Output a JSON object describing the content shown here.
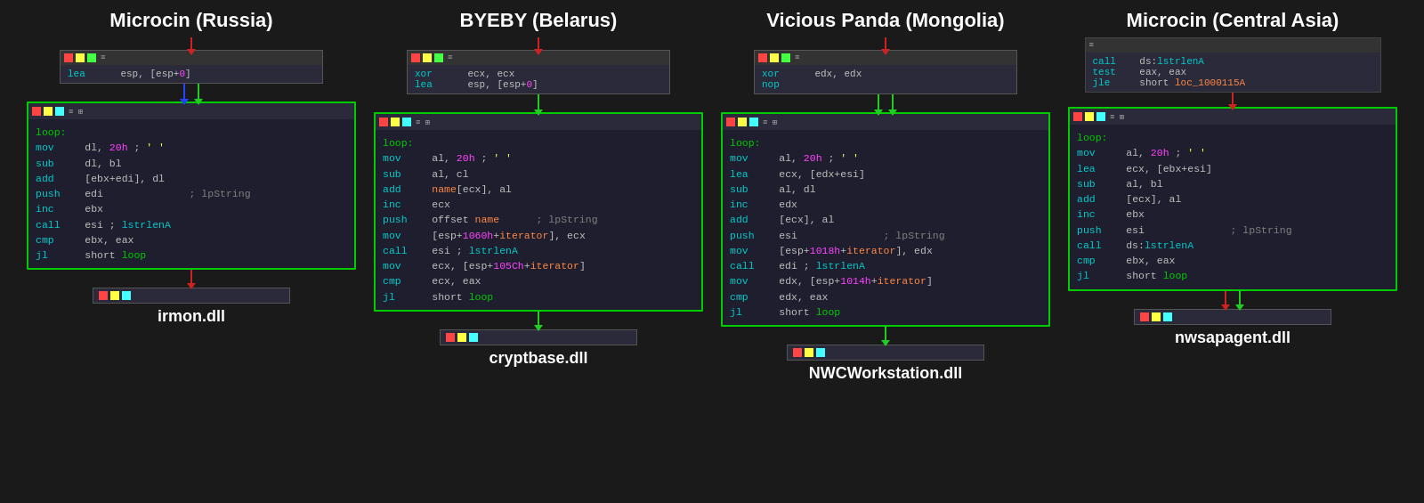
{
  "columns": [
    {
      "id": "col1",
      "title": "Microcin (Russia)",
      "snippet": {
        "lines": [
          {
            "text": "lea      esp, [esp+0]",
            "parts": [
              {
                "t": "lea",
                "c": "kw"
              },
              {
                "t": "      esp, [esp+0]",
                "c": "reg"
              }
            ]
          }
        ]
      },
      "main_code": {
        "lines": [
          {
            "raw": "loop:"
          },
          {
            "raw": "mov      dl, 20h ; ' '"
          },
          {
            "raw": "sub      dl, bl"
          },
          {
            "raw": "add      [ebx+edi], dl"
          },
          {
            "raw": "push     edi              ; lpString"
          },
          {
            "raw": "inc      ebx"
          },
          {
            "raw": "call     esi ; lstrlenA"
          },
          {
            "raw": "cmp      ebx, eax"
          },
          {
            "raw": "jl       short loop"
          }
        ]
      },
      "filename": "irmon.dll"
    },
    {
      "id": "col2",
      "title": "BYEBY (Belarus)",
      "snippet": {
        "lines": [
          {
            "raw": "xor      ecx, ecx"
          },
          {
            "raw": "lea      esp, [esp+0]"
          }
        ]
      },
      "main_code": {
        "lines": [
          {
            "raw": "loop:"
          },
          {
            "raw": "mov      al, 20h ; ' '"
          },
          {
            "raw": "sub      al, cl"
          },
          {
            "raw": "add      name[ecx], al"
          },
          {
            "raw": "inc      ecx"
          },
          {
            "raw": "push     offset name      ; lpString"
          },
          {
            "raw": "mov      [esp+1060h+iterator], ecx"
          },
          {
            "raw": "call     esi ; lstrlenA"
          },
          {
            "raw": "mov      ecx, [esp+105Ch+iterator]"
          },
          {
            "raw": "cmp      ecx, eax"
          },
          {
            "raw": "jl       short loop"
          }
        ]
      },
      "filename": "cryptbase.dll"
    },
    {
      "id": "col3",
      "title": "Vicious Panda (Mongolia)",
      "snippet": {
        "lines": [
          {
            "raw": "xor      edx, edx"
          },
          {
            "raw": "nop"
          }
        ]
      },
      "main_code": {
        "lines": [
          {
            "raw": "loop:"
          },
          {
            "raw": "mov      al, 20h ; ' '"
          },
          {
            "raw": "lea      ecx, [edx+esi]"
          },
          {
            "raw": "sub      al, dl"
          },
          {
            "raw": "inc      edx"
          },
          {
            "raw": "add      [ecx], al"
          },
          {
            "raw": "push     esi              ; lpString"
          },
          {
            "raw": "mov      [esp+1018h+iterator], edx"
          },
          {
            "raw": "call     edi ; lstrlenA"
          },
          {
            "raw": "mov      edx, [esp+1014h+iterator]"
          },
          {
            "raw": "cmp      edx, eax"
          },
          {
            "raw": "jl       short loop"
          }
        ]
      },
      "filename": "NWCWorkstation.dll"
    },
    {
      "id": "col4",
      "title": "Microcin (Central Asia)",
      "snippet": {
        "lines": [
          {
            "raw": "call     ds:lstrlenA"
          },
          {
            "raw": "test     eax, eax"
          },
          {
            "raw": "jle      short loc_1000115A"
          }
        ]
      },
      "main_code": {
        "lines": [
          {
            "raw": "loop:"
          },
          {
            "raw": "mov      al, 20h ; ' '"
          },
          {
            "raw": "lea      ecx, [ebx+esi]"
          },
          {
            "raw": "sub      al, bl"
          },
          {
            "raw": "add      [ecx], al"
          },
          {
            "raw": "inc      ebx"
          },
          {
            "raw": "push     esi              ; lpString"
          },
          {
            "raw": "call     ds:lstrlenA"
          },
          {
            "raw": "cmp      ebx, eax"
          },
          {
            "raw": "jl       short loop"
          }
        ]
      },
      "filename": "nwsapagent.dll"
    }
  ]
}
